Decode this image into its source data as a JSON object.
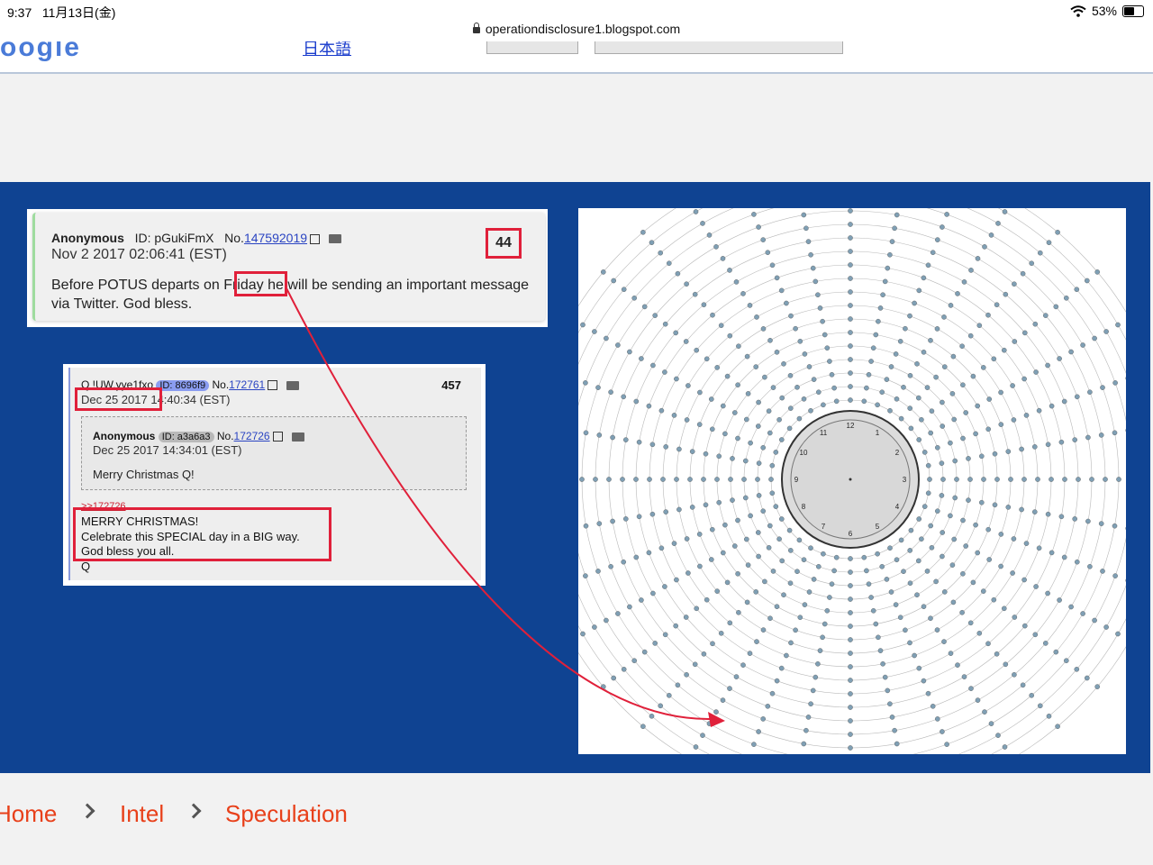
{
  "status_bar": {
    "time": "9:37",
    "date": "11月13日(金)",
    "battery": "53%"
  },
  "browser": {
    "url": "operationdisclosure1.blogspot.com"
  },
  "google_strip": {
    "logo_fragment": "oogle",
    "link_fragment": "日本語"
  },
  "post1": {
    "author": "Anonymous",
    "id_label": "ID: pGukiFmX",
    "no_label": "No.",
    "no_value": "147592019",
    "date": "Nov 2 2017 02:06:41 (EST)",
    "text_before": "Before POTUS departs on ",
    "highlight": "Friday",
    "text_after": " he will be sending an important message via Twitter. God bless.",
    "count": "44"
  },
  "post2": {
    "author": "Q !UW.yye1fxo",
    "id_label": "ID: 8696f9",
    "no_label": "No.",
    "no_value": "172761",
    "count": "457",
    "date_highlight": "Dec 25 2017",
    "date_rest": " 14:40:34 (EST)",
    "quote": {
      "author": "Anonymous",
      "id_label": "ID: a3a6a3",
      "no_label": "No.",
      "no_value": "172726",
      "date": "Dec 25 2017 14:34:01 (EST)",
      "text": "Merry Christmas Q!"
    },
    "reply_ref": ">>172726",
    "message": [
      "MERRY CHRISTMAS!",
      "Celebrate this SPECIAL day in a BIG way.",
      "God bless you all.",
      "Q"
    ]
  },
  "wheel": {
    "clock_numbers": [
      "12",
      "1",
      "2",
      "3",
      "4",
      "5",
      "6",
      "7",
      "8",
      "9",
      "10",
      "11"
    ]
  },
  "breadcrumb": {
    "items": [
      "Home",
      "Intel",
      "Speculation"
    ]
  },
  "colors": {
    "panel": "#0f4392",
    "highlight": "#e0203a",
    "breadcrumb": "#e8401a",
    "dot": "#7f9fb4"
  }
}
